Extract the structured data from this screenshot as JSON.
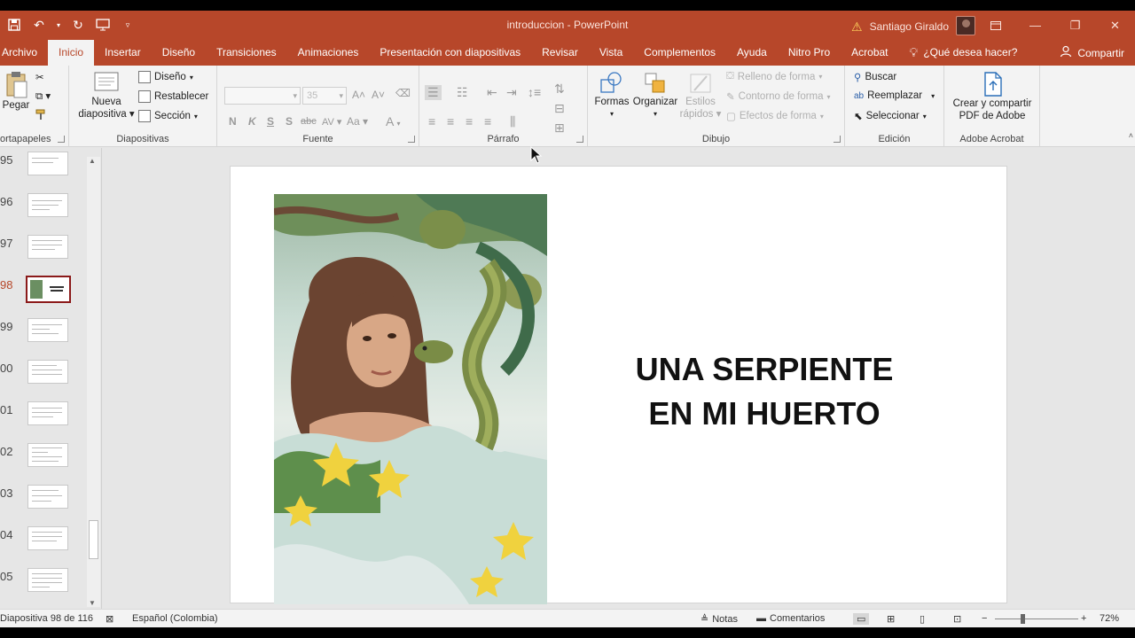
{
  "window": {
    "title": "introduccion  -  PowerPoint",
    "user": "Santiago Giraldo",
    "accent": "#b7472a"
  },
  "tabs": [
    {
      "label": "Archivo"
    },
    {
      "label": "Inicio"
    },
    {
      "label": "Insertar"
    },
    {
      "label": "Diseño"
    },
    {
      "label": "Transiciones"
    },
    {
      "label": "Animaciones"
    },
    {
      "label": "Presentación con diapositivas"
    },
    {
      "label": "Revisar"
    },
    {
      "label": "Vista"
    },
    {
      "label": "Complementos"
    },
    {
      "label": "Ayuda"
    },
    {
      "label": "Nitro Pro"
    },
    {
      "label": "Acrobat"
    }
  ],
  "tell_me": "¿Qué desea hacer?",
  "share": "Compartir",
  "ribbon": {
    "clipboard": {
      "paste": "Pegar",
      "label": "ortapapeles"
    },
    "slides": {
      "new_slide_1": "Nueva",
      "new_slide_2": "diapositiva",
      "layout": "Diseño",
      "reset": "Restablecer",
      "section": "Sección",
      "label": "Diapositivas"
    },
    "font": {
      "size": "35",
      "bold": "N",
      "italic": "K",
      "underline": "S",
      "shadow": "S",
      "strike": "abc",
      "spacing": "AV",
      "case": "Aa",
      "label": "Fuente"
    },
    "paragraph": {
      "label": "Párrafo"
    },
    "drawing": {
      "shapes": "Formas",
      "arrange": "Organizar",
      "quick_styles_1": "Estilos",
      "quick_styles_2": "rápidos",
      "fill": "Relleno de forma",
      "outline": "Contorno de forma",
      "effects": "Efectos de forma",
      "label": "Dibujo"
    },
    "editing": {
      "find": "Buscar",
      "replace": "Reemplazar",
      "select": "Seleccionar",
      "label": "Edición"
    },
    "acrobat": {
      "create_1": "Crear y compartir",
      "create_2": "PDF de Adobe",
      "label": "Adobe Acrobat"
    }
  },
  "thumbnails": [
    {
      "num": "95"
    },
    {
      "num": "96"
    },
    {
      "num": "97"
    },
    {
      "num": "98",
      "active": true
    },
    {
      "num": "99"
    },
    {
      "num": "00"
    },
    {
      "num": "01"
    },
    {
      "num": "02"
    },
    {
      "num": "03"
    },
    {
      "num": "04"
    },
    {
      "num": "05"
    }
  ],
  "slide": {
    "line1": "UNA SERPIENTE",
    "line2": "EN MI HUERTO"
  },
  "status": {
    "slide_info": "Diapositiva 98 de 116",
    "language": "Español (Colombia)",
    "notes": "Notas",
    "comments": "Comentarios",
    "zoom": "72%"
  }
}
